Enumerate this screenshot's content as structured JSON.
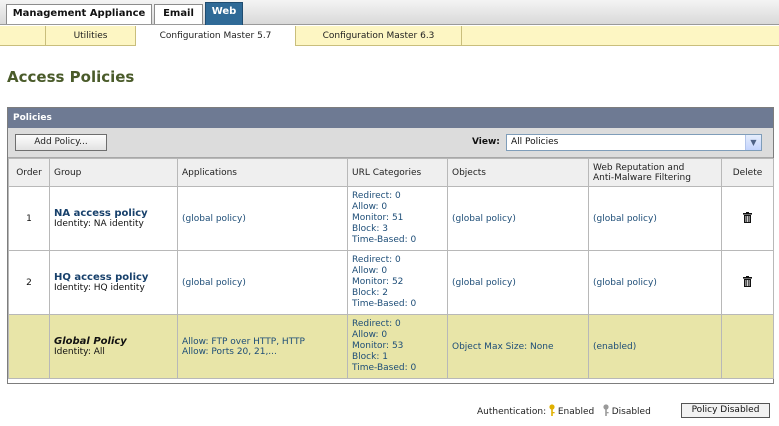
{
  "top_tabs": [
    {
      "label": "Management Appliance"
    },
    {
      "label": "Email"
    },
    {
      "label": "Web"
    }
  ],
  "sub_tabs": [
    {
      "label": "Utilities"
    },
    {
      "label": "Configuration Master 5.7"
    },
    {
      "label": "Configuration Master 6.3"
    }
  ],
  "page": {
    "title": "Access Policies"
  },
  "panel": {
    "title": "Policies",
    "add_button": "Add Policy...",
    "view_label": "View:",
    "view_value": "All Policies"
  },
  "table": {
    "headers": {
      "order": "Order",
      "group": "Group",
      "applications": "Applications",
      "url": "URL Categories",
      "objects": "Objects",
      "webrep_1": "Web Reputation and",
      "webrep_2": "Anti-Malware Filtering",
      "delete": "Delete"
    },
    "rows": [
      {
        "order": "1",
        "name": "NA access policy",
        "identity": "Identity: NA identity",
        "applications": "(global policy)",
        "url": [
          "Redirect: 0",
          "Allow: 0",
          "Monitor: 51",
          "Block: 3",
          "Time-Based: 0"
        ],
        "objects": "(global policy)",
        "webrep": "(global policy)"
      },
      {
        "order": "2",
        "name": "HQ access policy",
        "identity": "Identity: HQ identity",
        "applications": "(global policy)",
        "url": [
          "Redirect: 0",
          "Allow: 0",
          "Monitor: 52",
          "Block: 2",
          "Time-Based: 0"
        ],
        "objects": "(global policy)",
        "webrep": "(global policy)"
      },
      {
        "order": "",
        "name": "Global Policy",
        "identity": "Identity: All",
        "applications_1": "Allow: FTP over HTTP, HTTP",
        "applications_2": "Allow: Ports 20, 21,...",
        "url": [
          "Redirect: 0",
          "Allow: 0",
          "Monitor: 53",
          "Block: 1",
          "Time-Based: 0"
        ],
        "objects": "Object Max Size: None",
        "webrep": "(enabled)"
      }
    ]
  },
  "legend": {
    "label": "Authentication:",
    "enabled": "Enabled",
    "disabled": "Disabled",
    "policy_disabled": "Policy Disabled",
    "colors": {
      "enabled": "#e0b000",
      "disabled": "#9a9a9a"
    }
  },
  "colors": {
    "accent": "#2f6a97",
    "global_row": "#e8e5a8",
    "subbar": "#fdf6c3"
  }
}
